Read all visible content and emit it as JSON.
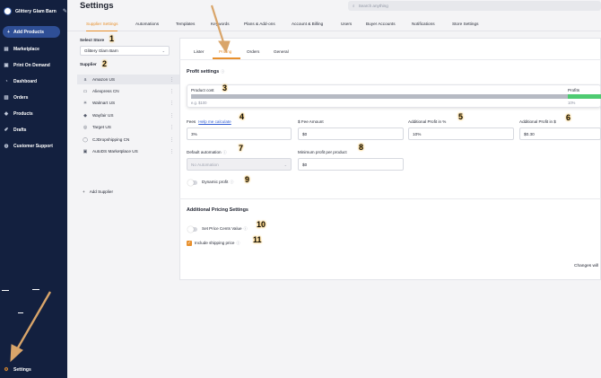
{
  "sidebar": {
    "store_name": "Glittery Glam Barn",
    "add_products": "Add Products",
    "items": [
      {
        "label": "Marketplace",
        "icon": "marketplace-icon"
      },
      {
        "label": "Print On Demand",
        "icon": "print-icon"
      },
      {
        "label": "Dashboard",
        "icon": "dashboard-icon"
      },
      {
        "label": "Orders",
        "icon": "orders-icon"
      },
      {
        "label": "Products",
        "icon": "products-icon"
      },
      {
        "label": "Drafts",
        "icon": "drafts-icon"
      },
      {
        "label": "Customer Support",
        "icon": "support-icon"
      }
    ],
    "settings": "Settings"
  },
  "header": {
    "title": "Settings",
    "search_placeholder": "Search anything"
  },
  "main_tabs": [
    "Supplier Settings",
    "Automations",
    "Templates",
    "Keywords",
    "Plans & Add-ons",
    "Account & Billing",
    "Users",
    "Buyer Accounts",
    "Notifications",
    "Store Settings"
  ],
  "left": {
    "select_store_label": "Select Store",
    "store_value": "Glittery Glam Barn",
    "supplier_label": "Supplier",
    "suppliers": [
      "Amazon US",
      "Aliexpress CN",
      "Walmart US",
      "Wayfair US",
      "Target US",
      "CJDropshipping CN",
      "AutoDS Marketplace US"
    ],
    "add_supplier": "Add Supplier"
  },
  "sub_tabs": [
    "Lister",
    "Pricing",
    "Orders",
    "General"
  ],
  "pricing": {
    "profit_settings": "Profit settings",
    "product_cost": "Product cost",
    "example": "e.g. $100",
    "profits": "Profits",
    "profits_pct": "10%",
    "fees_label": "Fees",
    "help_link": "Help me calculate",
    "fees_value": "3%",
    "fixed_fee_label": "$ Fee Amount",
    "fixed_fee_value": "$0",
    "add_profit_pct_label": "Additional Profit in %",
    "add_profit_pct_value": "10%",
    "add_profit_usd_label": "Additional Profit in $",
    "add_profit_usd_value": "$0.30",
    "default_automation_label": "Default automation",
    "default_automation_value": "No Automation",
    "min_profit_label": "Minimum profit per product",
    "min_profit_value": "$0",
    "dynamic_profit": "Dynamic profit",
    "additional_title": "Additional Pricing Settings",
    "cents_label": "Set Price Cents Value",
    "shipping_label": "Include shipping price",
    "changes_text": "Changes will"
  },
  "badges": [
    "1",
    "2",
    "3",
    "4",
    "5",
    "6",
    "7",
    "8",
    "9",
    "10",
    "11"
  ],
  "colors": {
    "sidebar": "#13203f",
    "accent": "#e8902d",
    "link": "#2f5bd3",
    "profit_bar": "#4ecb71",
    "badge_glow": "#f2b63b",
    "arrow": "#d9a56a"
  }
}
